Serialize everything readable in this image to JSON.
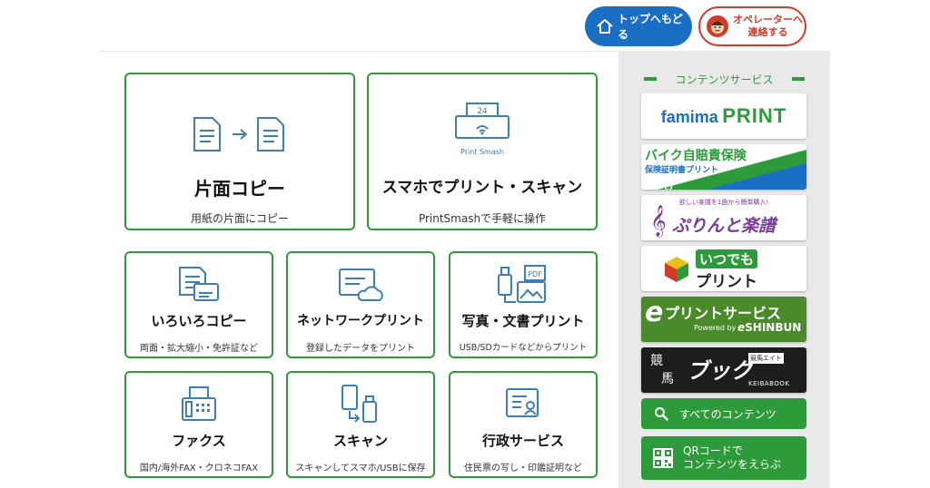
{
  "header": {
    "home_label": "トップへもどる",
    "operator_label": "オペレーターへ\n連絡する"
  },
  "tiles": {
    "single_copy": {
      "title": "片面コピー",
      "subtitle": "用紙の片面にコピー"
    },
    "smartphone_print": {
      "title": "スマホでプリント・スキャン",
      "subtitle": "PrintSmashで手軽に操作",
      "icon_text_top": "24",
      "icon_text_bottom": "Print Smash"
    },
    "various_copy": {
      "title": "いろいろコピー",
      "subtitle": "両面・拡大縮小・免許証など"
    },
    "network_print": {
      "title": "ネットワークプリント",
      "subtitle": "登録したデータをプリント"
    },
    "photo_doc_print": {
      "title": "写真・文書プリント",
      "subtitle": "USB/SDカードなどからプリント",
      "icon_text": "PDF"
    },
    "fax": {
      "title": "ファクス",
      "subtitle": "国内/海外FAX・クロネコFAX"
    },
    "scan": {
      "title": "スキャン",
      "subtitle": "スキャンしてスマホ/USBに保存"
    },
    "admin": {
      "title": "行政サービス",
      "subtitle": "住民票の写し・印鑑証明など"
    }
  },
  "sidebar": {
    "heading": "コンテンツサービス",
    "banners": {
      "famima_print": {
        "text_a": "famima",
        "text_b": "PRINT"
      },
      "bike_insurance": {
        "title": "バイク自賠責保険",
        "subtitle": "保険証明書プリント"
      },
      "sheet_music": {
        "small": "欲しい楽譜を1曲から簡単購入!",
        "title": "ぷりんと楽譜"
      },
      "itsudemo_print": {
        "line1": "いつでも",
        "line2": "プリント"
      },
      "e_print": {
        "title": "プリントサービス",
        "e": "e",
        "powered": "Powered by",
        "shinbun": "SHINBUN"
      },
      "keiba_book": {
        "kanji1": "競",
        "kanji2": "馬",
        "title": "ブック",
        "sub": "KEIBABOOK",
        "badge": "競馬エイト"
      }
    },
    "all_contents_label": "すべてのコンテンツ",
    "qr_label": "QRコードで\nコンテンツをえらぶ"
  },
  "colors": {
    "green": "#2e9b3a",
    "blue": "#1a6fc4",
    "red": "#d23a2a",
    "icon_blue": "#3d7fb0"
  }
}
